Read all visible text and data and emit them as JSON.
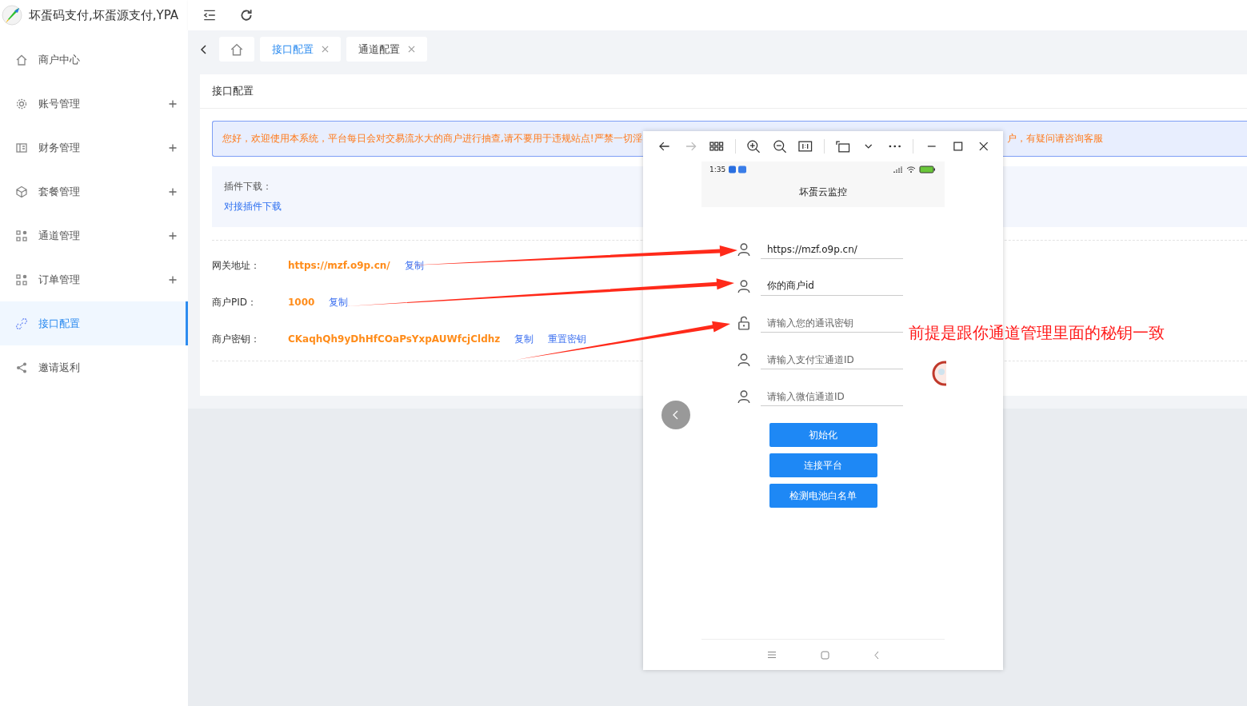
{
  "app": {
    "title": "坏蛋码支付,坏蛋源支付,YPA"
  },
  "sidebar": {
    "items": [
      {
        "label": "商户中心",
        "kind": "home",
        "expandable": false,
        "selected": false
      },
      {
        "label": "账号管理",
        "kind": "gear",
        "expandable": true,
        "selected": false
      },
      {
        "label": "财务管理",
        "kind": "book",
        "expandable": true,
        "selected": false
      },
      {
        "label": "套餐管理",
        "kind": "box",
        "expandable": true,
        "selected": false
      },
      {
        "label": "通道管理",
        "kind": "grid",
        "expandable": true,
        "selected": false
      },
      {
        "label": "订单管理",
        "kind": "grid",
        "expandable": true,
        "selected": false
      },
      {
        "label": "接口配置",
        "kind": "link",
        "expandable": false,
        "selected": true
      },
      {
        "label": "邀请返利",
        "kind": "share",
        "expandable": false,
        "selected": false
      }
    ]
  },
  "tabs": [
    {
      "kind": "home",
      "selected": false
    },
    {
      "kind": "page",
      "label": "接口配置",
      "selected": true
    },
    {
      "kind": "page",
      "label": "通道配置",
      "selected": false
    }
  ],
  "card": {
    "title": "接口配置",
    "notice": {
      "start": "您好，欢迎使用本系统，平台每日会对交易流水大的商户进行抽查,请不要用于违规站点!严禁一切淫",
      "end": "户，有疑问请咨询客服"
    },
    "plugin": {
      "label": "插件下载：",
      "link": "对接插件下载"
    },
    "fields": [
      {
        "label": "网关地址：",
        "value": "https://mzf.o9p.cn/",
        "actions": [
          "复制"
        ]
      },
      {
        "label": "商户PID：",
        "value": "1000",
        "actions": [
          "复制"
        ]
      },
      {
        "label": "商户密钥：",
        "value": "CKaqhQh9yDhHfCOaPsYxpAUWfcjCldhz",
        "actions": [
          "复制",
          "重置密钥"
        ]
      }
    ]
  },
  "viewer": {
    "phone": {
      "time": "1:35",
      "app_title": "坏蛋云监控",
      "inputs": [
        {
          "kind": "user",
          "value": "https://mzf.o9p.cn/"
        },
        {
          "kind": "user",
          "value": "你的商户id"
        },
        {
          "kind": "lock",
          "placeholder": "请输入您的通讯密钥"
        },
        {
          "kind": "user",
          "placeholder": "请输入支付宝通道ID"
        },
        {
          "kind": "user",
          "placeholder": "请输入微信通道ID"
        }
      ],
      "buttons": [
        "初始化",
        "连接平台",
        "检测电池白名单"
      ]
    }
  },
  "annotation": {
    "text": "前提是跟你通道管理里面的秘钥一致"
  }
}
